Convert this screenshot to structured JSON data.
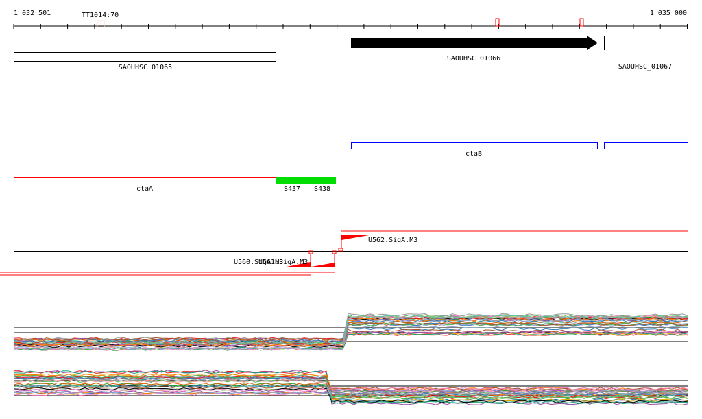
{
  "ruler": {
    "start_label": "1 032 501",
    "end_label": "1 035 000",
    "marker_label": "TT1014:70"
  },
  "genes": [
    {
      "name": "SAOUHSC_01065"
    },
    {
      "name": "SAOUHSC_01066"
    },
    {
      "name": "SAOUHSC_01067"
    }
  ],
  "operons": {
    "ctaB": "ctaB",
    "ctaA": "ctaA"
  },
  "segments": [
    "S437",
    "S438"
  ],
  "promoters": [
    "U560.SigA.M3",
    "U561.SigA.M3",
    "U562.SigA.M3"
  ],
  "colors": {
    "red": "#ff0000",
    "green": "#00dd00",
    "blue": "#0000ff",
    "black": "#000000"
  }
}
